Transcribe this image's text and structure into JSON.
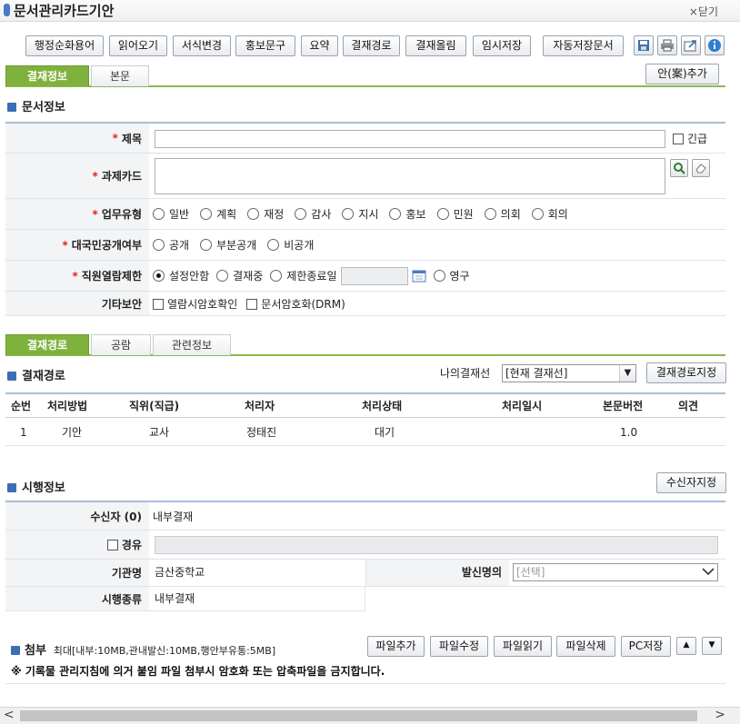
{
  "window": {
    "title": "문서관리카드기안",
    "close_label": "×닫기"
  },
  "toolbar": {
    "buttons": [
      "행정순화용어",
      "읽어오기",
      "서식변경",
      "홍보문구",
      "요약",
      "결재경로",
      "결재올림",
      "임시저장",
      "자동저장문서"
    ],
    "icons": [
      "save-icon",
      "print-icon",
      "export-icon",
      "info-icon"
    ]
  },
  "top_tabs": {
    "tabs": [
      "결재정보",
      "본문"
    ],
    "active": "결재정보",
    "add_draft_label": "안(案)추가"
  },
  "doc_info": {
    "section_title": "문서정보",
    "title_label": "제목",
    "urgent_label": "긴급",
    "task_card_label": "과제카드",
    "work_type_label": "업무유형",
    "work_types": [
      "일반",
      "계획",
      "재정",
      "감사",
      "지시",
      "홍보",
      "민원",
      "의회",
      "회의"
    ],
    "public_label": "대국민공개여부",
    "public_options": [
      "공개",
      "부분공개",
      "비공개"
    ],
    "staff_label": "직원열람제한",
    "staff_options": [
      "설정안함",
      "결재중",
      "제한종료일",
      "영구"
    ],
    "staff_selected": "설정안함",
    "security_label": "기타보안",
    "security_options": [
      "열람시암호확인",
      "문서암호화(DRM)"
    ]
  },
  "approval_tabs": {
    "tabs": [
      "결재경로",
      "공람",
      "관련정보"
    ],
    "active": "결재경로"
  },
  "approval_path": {
    "section_title": "결재경로",
    "my_line_label": "나의결재선",
    "my_line_value": "[현재 결재선]",
    "set_path_label": "결재경로지정",
    "columns": [
      "순번",
      "처리방법",
      "직위(직급)",
      "처리자",
      "처리상태",
      "처리일시",
      "본문버전",
      "의견"
    ],
    "rows": [
      {
        "no": "1",
        "method": "기안",
        "position": "교사",
        "handler": "정태진",
        "status": "대기",
        "datetime": "",
        "version": "1.0",
        "opinion": ""
      }
    ]
  },
  "enforcement": {
    "section_title": "시행정보",
    "set_recipient_label": "수신자지정",
    "recipient_label": "수신자 (0)",
    "recipient_value": "내부결재",
    "via_label": "경유",
    "org_label": "기관명",
    "org_value": "금산중학교",
    "sender_label": "발신명의",
    "sender_value": "[선택]",
    "type_label": "시행종류",
    "type_value": "내부결재"
  },
  "attachment": {
    "label": "첨부",
    "limits": "최대[내부:10MB,관내발신:10MB,행안부유통:5MB]",
    "buttons": [
      "파일추가",
      "파일수정",
      "파일읽기",
      "파일삭제",
      "PC저장"
    ],
    "notice": "※ 기록물 관리지침에 의거 붙임 파일 첨부시 암호화 또는 압축파일을 금지합니다."
  },
  "colors": {
    "accent_green": "#7fb23c",
    "section_blue": "#3a6fb5",
    "required_red": "#dd2222"
  }
}
